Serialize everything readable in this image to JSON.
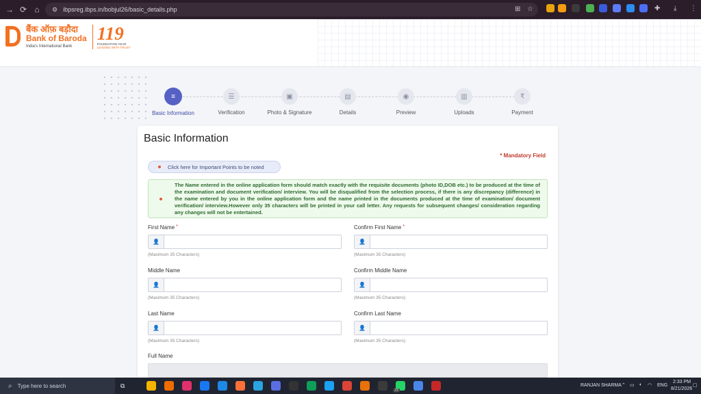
{
  "browser": {
    "url": "ibpsreg.ibps.in/bobjul26/basic_details.php",
    "ext_colors": [
      "#e8a20c",
      "#f39c12",
      "#3b3b3b",
      "#4caf50",
      "#3b5bdb",
      "#5c7cfa",
      "#2d8cf0",
      "#4c6ef5"
    ]
  },
  "header": {
    "logo_hindi": "बैंक ऑफ़ बड़ौदा",
    "logo_english": "Bank of Baroda",
    "logo_tagline": "India's International Bank",
    "anniversary_number": "119",
    "anniversary_caption": "FOUNDATION YEAR",
    "anniversary_subcaption": "LEADING WITH TRUST"
  },
  "stepper": {
    "steps": [
      {
        "label": "Basic Information",
        "icon": "list-icon",
        "glyph": "≡",
        "active": true
      },
      {
        "label": "Verification",
        "icon": "checklist-icon",
        "glyph": "☰",
        "active": false
      },
      {
        "label": "Photo & Signature",
        "icon": "image-icon",
        "glyph": "▣",
        "active": false
      },
      {
        "label": "Details",
        "icon": "document-icon",
        "glyph": "▤",
        "active": false
      },
      {
        "label": "Preview",
        "icon": "eye-icon",
        "glyph": "◉",
        "active": false
      },
      {
        "label": "Uploads",
        "icon": "file-icon",
        "glyph": "▥",
        "active": false
      },
      {
        "label": "Payment",
        "icon": "rupee-icon",
        "glyph": "₹",
        "active": false
      }
    ]
  },
  "form": {
    "title": "Basic Information",
    "mandatory_label": "* Mandatory Field",
    "important_points_label": "Click here for Important Points to be noted",
    "notice": "The Name entered in the online application form should match exactly with the requisite documents (photo ID,DOB etc.) to be produced at the time of the examination and document verification/ interview. You will be disqualified from the selection process, if there is any discrepancy (difference) in the name entered by you in the online application form and the name printed in the documents produced at the time of examination/ document verification/ interview.However only 35 characters will be printed in your call letter. Any requests for subsequent changes/ consideration regarding any changes will not be entertained.",
    "required_mark": "*",
    "hint": "(Maximum 35 Characters)",
    "fields": {
      "first_name": {
        "label": "First Name",
        "value": ""
      },
      "confirm_first_name": {
        "label": "Confirm First Name",
        "value": ""
      },
      "middle_name": {
        "label": "Middle Name",
        "value": ""
      },
      "confirm_middle_name": {
        "label": "Confirm Middle Name",
        "value": ""
      },
      "last_name": {
        "label": "Last Name",
        "value": ""
      },
      "confirm_last_name": {
        "label": "Confirm Last Name",
        "value": ""
      },
      "full_name": {
        "label": "Full Name",
        "value": ""
      }
    }
  },
  "taskbar": {
    "search_placeholder": "Type here to search",
    "user": "RANJAN SHARMA",
    "language": "ENG",
    "time": "2:33 PM",
    "date": "8/21/2026",
    "badge": "23",
    "app_colors": [
      "#f5b400",
      "#ef6c00",
      "#e1306c",
      "#1877f2",
      "#1e88e5",
      "#ff7139",
      "#2aa3e0",
      "#5b6ee1",
      "#333",
      "#0f9d58",
      "#1da1f2",
      "#db4437",
      "#e8710a",
      "#3b3b3b",
      "#25d366",
      "#4a86e8",
      "#c62828"
    ]
  }
}
